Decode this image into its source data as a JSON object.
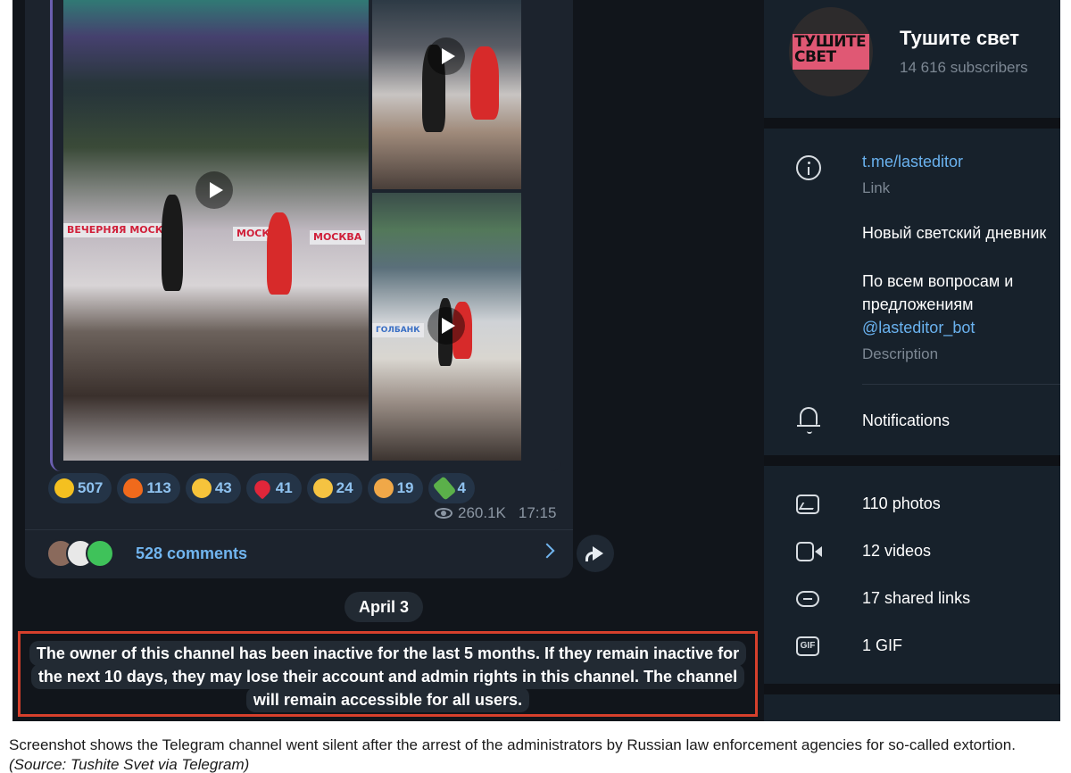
{
  "post": {
    "media": [
      {
        "type": "video",
        "banners": [
          "ВЕЧЕРНЯЯ МОСКВА",
          "МОСКВА",
          "МОСКВА"
        ]
      },
      {
        "type": "video"
      },
      {
        "type": "video",
        "banners": [
          "ГОЛБАНК"
        ]
      }
    ],
    "reactions": [
      {
        "emoji": "thumbs-up",
        "color": "#f4c020",
        "count": "507"
      },
      {
        "emoji": "fire",
        "color": "#f06a1c",
        "count": "113"
      },
      {
        "emoji": "rofl",
        "color": "#f6c33a",
        "count": "43"
      },
      {
        "emoji": "heart",
        "color": "#e0263a",
        "count": "41"
      },
      {
        "emoji": "heart-eyes",
        "color": "#f5c342",
        "count": "24"
      },
      {
        "emoji": "exploding-head",
        "color": "#f0a848",
        "count": "19"
      },
      {
        "emoji": "champagne",
        "color": "#5bb04a",
        "count": "4"
      }
    ],
    "views": "260.1K",
    "time": "17:15",
    "comments": "528 comments"
  },
  "date_separator": "April 3",
  "notice": {
    "lines": [
      "The owner of this channel has been inactive for the last 5 months. If they remain inactive for",
      "the next 10 days, they may lose their account and admin rights in this channel. The channel",
      "will remain accessible for all users."
    ],
    "highlight_color": "#d6402c"
  },
  "channel": {
    "avatar_text_line1": "ТУШИТЕ",
    "avatar_text_line2": "СВЕТ",
    "name": "Тушите свет",
    "subscribers": "14 616 subscribers",
    "link": "t.me/lasteditor",
    "link_label": "Link",
    "description_line1": "Новый светский дневник",
    "description_line2": "По всем вопросам и",
    "description_line3": "предложениям",
    "description_mention": "@lasteditor_bot",
    "description_label": "Description",
    "notifications": "Notifications",
    "media": {
      "photos": "110 photos",
      "videos": "12 videos",
      "links": "17 shared links",
      "gif": "1 GIF",
      "gif_icon_text": "GIF"
    }
  },
  "caption": {
    "text": "Screenshot shows the Telegram channel went silent after the arrest of the administrators by Russian law enforcement agencies for so-called extortion.",
    "source": "(Source: Tushite Svet via Telegram)"
  }
}
